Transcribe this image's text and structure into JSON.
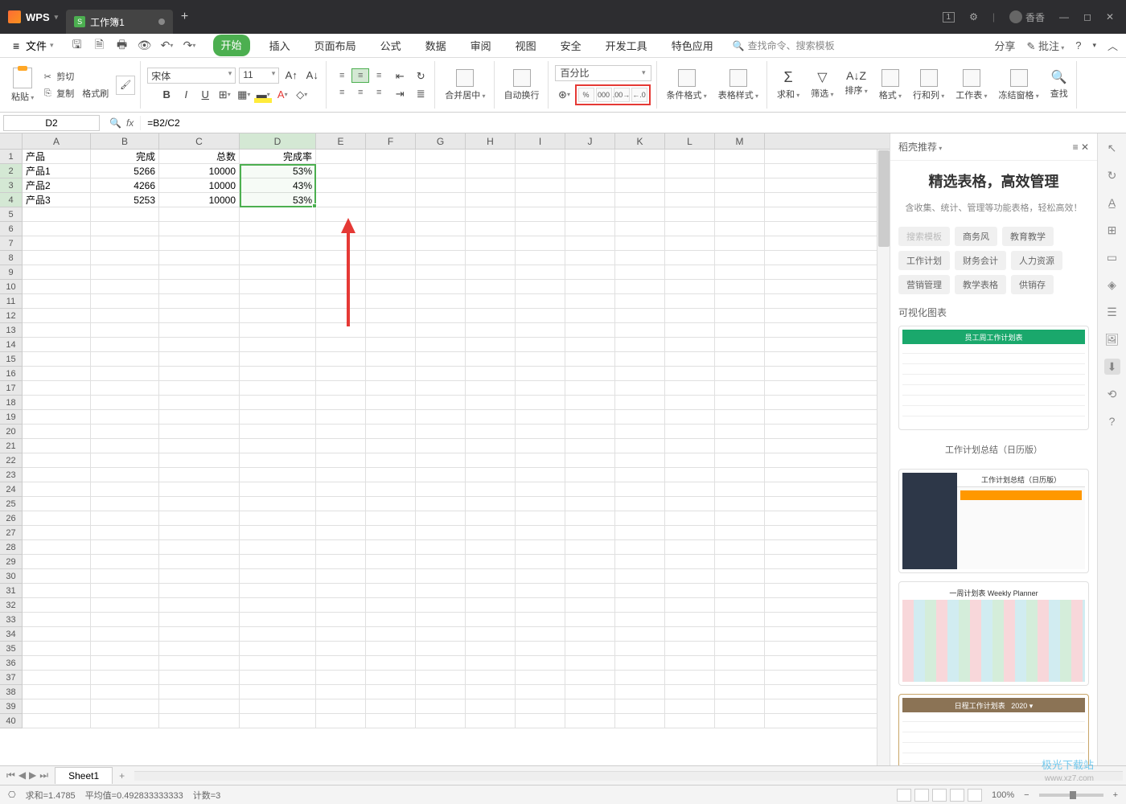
{
  "titlebar": {
    "app_name": "WPS",
    "doc_tab": "工作簿1",
    "tray_number": "1",
    "user_name": "香香"
  },
  "menubar": {
    "file": "文件",
    "tabs": [
      "开始",
      "插入",
      "页面布局",
      "公式",
      "数据",
      "审阅",
      "视图",
      "安全",
      "开发工具",
      "特色应用"
    ],
    "active_index": 0,
    "search_placeholder": "查找命令、搜索模板",
    "share": "分享",
    "comment": "批注"
  },
  "ribbon": {
    "paste": "粘贴",
    "cut": "剪切",
    "copy": "复制",
    "format_painter": "格式刷",
    "font_name": "宋体",
    "font_size": "11",
    "merge_center": "合并居中",
    "wrap_text": "自动换行",
    "number_format": "百分比",
    "conditional_format": "条件格式",
    "table_style": "表格样式",
    "sum": "求和",
    "filter": "筛选",
    "sort": "排序",
    "format": "格式",
    "rowcol": "行和列",
    "worksheet": "工作表",
    "freeze": "冻结窗格",
    "find": "查找"
  },
  "formula_bar": {
    "cell_ref": "D2",
    "formula": "=B2/C2"
  },
  "grid": {
    "columns": [
      "A",
      "B",
      "C",
      "D",
      "E",
      "F",
      "G",
      "H",
      "I",
      "J",
      "K",
      "L",
      "M"
    ],
    "row_count": 40,
    "headers": {
      "A": "产品",
      "B": "完成",
      "C": "总数",
      "D": "完成率"
    },
    "data": [
      {
        "A": "产品1",
        "B": "5266",
        "C": "10000",
        "D": "53%"
      },
      {
        "A": "产品2",
        "B": "4266",
        "C": "10000",
        "D": "43%"
      },
      {
        "A": "产品3",
        "B": "5253",
        "C": "10000",
        "D": "53%"
      }
    ],
    "selected_col": "D",
    "selected_rows": [
      2,
      3,
      4
    ]
  },
  "right_panel": {
    "header": "稻壳推荐",
    "title": "精选表格，高效管理",
    "subtitle": "含收集、统计、管理等功能表格，轻松高效！",
    "tags_row1": [
      "搜索模板",
      "商务风",
      "教育教学"
    ],
    "tags_row2": [
      "工作计划",
      "财务会计",
      "人力资源"
    ],
    "tags_row3": [
      "营销管理",
      "教学表格",
      "供销存"
    ],
    "section": "可视化图表",
    "thumb_captions": [
      "工作计划总结（日历版）",
      "",
      ""
    ]
  },
  "sheet_bar": {
    "sheet_name": "Sheet1"
  },
  "status_bar": {
    "sum": "求和=1.4785",
    "avg": "平均值=0.492833333333",
    "count": "计数=3",
    "zoom": "100%"
  },
  "watermark": {
    "big": "极光下载站",
    "small": "www.xz7.com"
  }
}
